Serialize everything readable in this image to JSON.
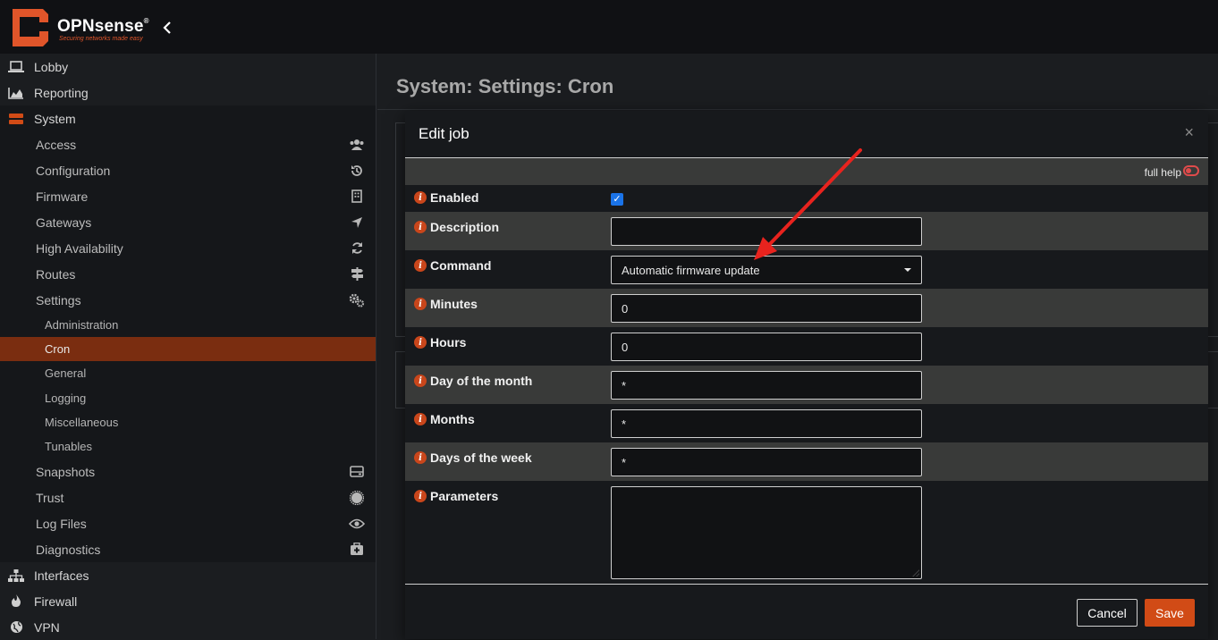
{
  "brand": {
    "name": "OPNsense",
    "reg": "®",
    "tagline": "Securing networks made easy",
    "collapse_icon": "chevron-left-icon"
  },
  "sidebar": {
    "top_items": [
      {
        "label": "Lobby",
        "icon": "laptop-icon"
      },
      {
        "label": "Reporting",
        "icon": "area-chart-icon"
      },
      {
        "label": "System",
        "icon": "server-icon"
      }
    ],
    "system_items": [
      {
        "label": "Access",
        "icon": "users-icon"
      },
      {
        "label": "Configuration",
        "icon": "history-icon"
      },
      {
        "label": "Firmware",
        "icon": "building-icon"
      },
      {
        "label": "Gateways",
        "icon": "location-arrow-icon"
      },
      {
        "label": "High Availability",
        "icon": "refresh-icon"
      },
      {
        "label": "Routes",
        "icon": "map-signs-icon"
      },
      {
        "label": "Settings",
        "icon": "cogs-icon"
      }
    ],
    "settings_items": [
      {
        "label": "Administration"
      },
      {
        "label": "Cron",
        "active": true
      },
      {
        "label": "General"
      },
      {
        "label": "Logging"
      },
      {
        "label": "Miscellaneous"
      },
      {
        "label": "Tunables"
      }
    ],
    "system_items_after": [
      {
        "label": "Snapshots",
        "icon": "hdd-icon"
      },
      {
        "label": "Trust",
        "icon": "certificate-icon"
      },
      {
        "label": "Log Files",
        "icon": "eye-icon"
      },
      {
        "label": "Diagnostics",
        "icon": "medkit-icon"
      }
    ],
    "bottom_items": [
      {
        "label": "Interfaces",
        "icon": "sitemap-icon"
      },
      {
        "label": "Firewall",
        "icon": "fire-icon"
      },
      {
        "label": "VPN",
        "icon": "globe-icon"
      }
    ]
  },
  "page": {
    "title": "System: Settings: Cron"
  },
  "modal": {
    "title": "Edit job",
    "close_label": "×",
    "full_help_label": "full help",
    "fields": {
      "enabled": {
        "label": "Enabled",
        "checked": true
      },
      "description": {
        "label": "Description",
        "value": ""
      },
      "command": {
        "label": "Command",
        "value": "Automatic firmware update"
      },
      "minutes": {
        "label": "Minutes",
        "value": "0"
      },
      "hours": {
        "label": "Hours",
        "value": "0"
      },
      "day_of_month": {
        "label": "Day of the month",
        "value": "*"
      },
      "months": {
        "label": "Months",
        "value": "*"
      },
      "days_of_week": {
        "label": "Days of the week",
        "value": "*"
      },
      "parameters": {
        "label": "Parameters",
        "value": ""
      }
    },
    "cancel_label": "Cancel",
    "save_label": "Save",
    "info_icon": "info-icon"
  },
  "colors": {
    "accent": "#d14b16",
    "active_nav": "#7a2d10",
    "annotation_arrow": "#e8231e",
    "checkbox": "#1a73e8"
  }
}
